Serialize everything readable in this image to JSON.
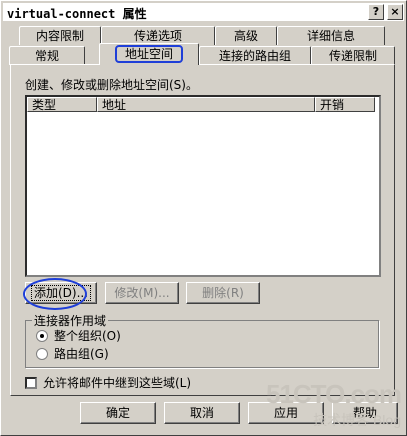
{
  "window": {
    "title": "virtual-connect 属性",
    "help_label": "?",
    "close_label": "×"
  },
  "tabs": {
    "row1": [
      {
        "label": "内容限制"
      },
      {
        "label": "传递选项"
      },
      {
        "label": "高级"
      },
      {
        "label": "详细信息"
      }
    ],
    "row2": [
      {
        "label": "常规"
      },
      {
        "label": "地址空间",
        "active": true
      },
      {
        "label": "连接的路由组"
      },
      {
        "label": "传递限制"
      }
    ]
  },
  "panel": {
    "description": "创建、修改或删除地址空间(S)。",
    "list": {
      "columns": [
        "类型",
        "地址",
        "开销"
      ],
      "rows": []
    },
    "buttons": {
      "add": "添加(D)...",
      "modify": "修改(M)...",
      "delete": "删除(R)"
    },
    "scope": {
      "title": "连接器作用域",
      "options": [
        {
          "label": "整个组织(O)",
          "checked": true
        },
        {
          "label": "路由组(G)",
          "checked": false
        }
      ]
    },
    "relay_checkbox": {
      "label": "允许将邮件中继到这些域(L)",
      "checked": false
    }
  },
  "footer": {
    "ok": "确定",
    "cancel": "取消",
    "apply": "应用",
    "help": "帮助"
  },
  "watermark": {
    "main": "51CTO.com",
    "sub": "技术博客  Blog"
  },
  "colors": {
    "dialog_bg": "#d4d0c8",
    "annotation": "#1f3fd8"
  }
}
